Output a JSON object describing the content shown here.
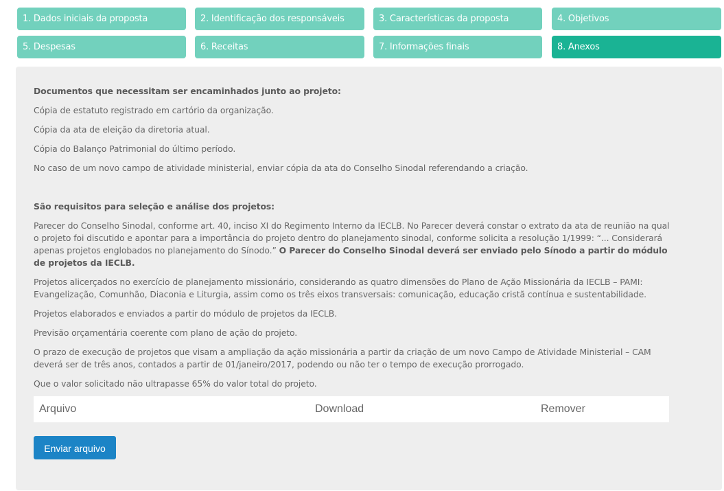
{
  "tabs": [
    {
      "label": "1. Dados iniciais da proposta",
      "active": false
    },
    {
      "label": "2. Identificação dos responsáveis",
      "active": false
    },
    {
      "label": "3. Características da proposta",
      "active": false
    },
    {
      "label": "4. Objetivos",
      "active": false
    },
    {
      "label": "5. Despesas",
      "active": false
    },
    {
      "label": "6. Receitas",
      "active": false
    },
    {
      "label": "7. Informações finais",
      "active": false
    },
    {
      "label": "8. Anexos",
      "active": true
    }
  ],
  "documents": {
    "heading": "Documentos que necessitam ser encaminhados junto ao projeto:",
    "items": [
      "Cópia de estatuto registrado em cartório da organização.",
      "Cópia da ata de eleição da diretoria atual.",
      "Cópia do Balanço Patrimonial do último período.",
      "No caso de um novo campo de atividade ministerial, enviar cópia da ata do Conselho Sinodal referendando a criação."
    ]
  },
  "requirements": {
    "heading": "São requisitos para seleção e análise dos projetos:",
    "item1_text": "Parecer do Conselho Sinodal, conforme art. 40, inciso XI do Regimento Interno da IECLB. No Parecer deverá constar o extrato da ata de reunião na qual o projeto foi discutido e apontar para a importância do projeto dentro do planejamento sinodal, conforme solicita a resolução 1/1999: “... Considerará apenas projetos englobados no planejamento do Sínodo.”",
    "item1_bold": "O Parecer do Conselho Sinodal deverá ser enviado pelo Sínodo a partir do módulo de projetos da IECLB.",
    "items": [
      "Projetos alicerçados no exercício de planejamento missionário, considerando as quatro dimensões do Plano de Ação Missionária da IECLB – PAMI: Evangelização, Comunhão, Diaconia e Liturgia, assim como os três eixos transversais: comunicação, educação cristã contínua e sustentabilidade.",
      "Projetos elaborados e enviados a partir do módulo de projetos da IECLB.",
      "Previsão orçamentária coerente com plano de ação do projeto.",
      "O prazo de execução de projetos que visam a ampliação da ação missionária a partir da criação de um novo Campo de Atividade Ministerial – CAM deverá ser de três anos, contados a partir de 01/janeiro/2017, podendo ou não ter o tempo de execução prorrogado.",
      "Que o valor solicitado não ultrapasse 65% do valor total do projeto."
    ]
  },
  "files_table": {
    "columns": [
      "Arquivo",
      "Download",
      "Remover"
    ]
  },
  "upload_button": {
    "label": "Enviar arquivo"
  },
  "colors": {
    "tab": "#72d1bd",
    "tab_active": "#1ab394",
    "panel": "#eeeeee",
    "button": "#1c84c6"
  }
}
